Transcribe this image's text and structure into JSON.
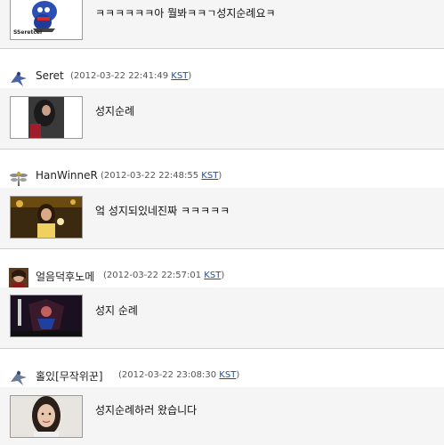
{
  "comments": [
    {
      "username": "",
      "timestamp": "",
      "tz": "",
      "message": "ㅋㅋㅋㅋㅋㅋ아 뭘봐ㅋㅋㄱ성지순례요ㅋ",
      "thumb_text": "SSeretcel",
      "avatar_icon": "bird-icon",
      "thumb_icon": "blue-cartoon-character-image"
    },
    {
      "username": "Seret",
      "timestamp": "(2012-03-22 22:41:49",
      "tz": "KST",
      "message": "성지순례",
      "avatar_icon": "bird-icon",
      "thumb_icon": "dark-hair-person-image"
    },
    {
      "username": "HanWinneR",
      "timestamp": "(2012-03-22 22:48:55",
      "tz": "KST",
      "message": "엌 성지되있네진짜 ㅋㅋㅋㅋㅋ",
      "avatar_icon": "dragonfly-icon",
      "thumb_icon": "singer-performance-image"
    },
    {
      "username": "얼음덕후노메",
      "timestamp": "(2012-03-22 22:57:01",
      "tz": "KST",
      "message": "성지 순례",
      "avatar_icon": "portrait-avatar-icon",
      "thumb_icon": "anime-character-image"
    },
    {
      "username": "홀있[무작위꾼]",
      "timestamp": "(2012-03-22 23:08:30",
      "tz": "KST",
      "message": "성지순례하러 왔습니다",
      "avatar_icon": "bird-icon",
      "thumb_icon": "girl-portrait-image"
    }
  ],
  "colors": {
    "body_bg": "#f5f5f5",
    "divider": "#cfcfcf",
    "link": "#1a4fa0"
  }
}
